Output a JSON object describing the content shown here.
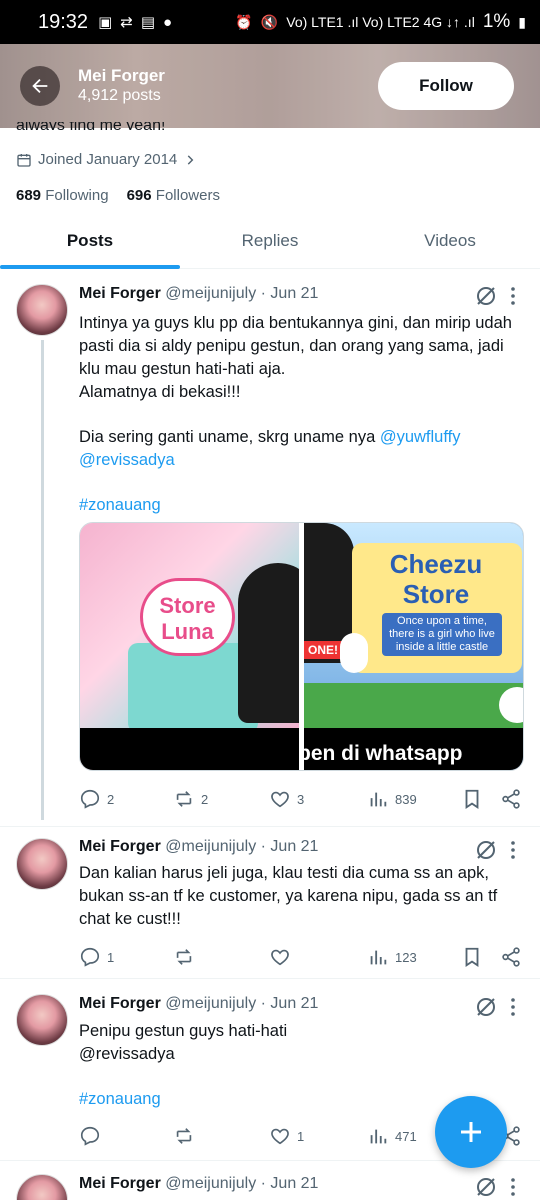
{
  "status_bar": {
    "time": "19:32",
    "network": "Vo) LTE1 .ıl Vo) LTE2 4G ↓↑ .ıl",
    "battery": "1%"
  },
  "header": {
    "name": "Mei Forger",
    "posts": "4,912 posts",
    "follow_label": "Follow"
  },
  "profile": {
    "bio_cut": "always find me yeah!",
    "joined": "Joined January 2014",
    "following_count": "689",
    "following_label": "Following",
    "followers_count": "696",
    "followers_label": "Followers"
  },
  "tabs": [
    {
      "label": "Posts"
    },
    {
      "label": "Replies"
    },
    {
      "label": "Videos"
    }
  ],
  "tweets": [
    {
      "name": "Mei Forger",
      "handle": "@meijunijuly",
      "date": "· Jun 21",
      "line1": "Intinya ya guys klu pp dia bentukannya gini, dan mirip udah pasti dia si aldy penipu gestun, dan orang yang sama, jadi klu mau gestun hati-hati aja.",
      "line2": "Alamatnya di bekasi!!!",
      "line3": "Dia sering ganti uname, skrg uname nya ",
      "mention1": "@yuwfluffy",
      "mention2": "@revissadya",
      "hashtag": "#zonauang",
      "media": {
        "img1_text": "Store Luna",
        "img2_title": "Cheezu Store",
        "img2_sub": "Once upon a time, there is a girl who live inside a little castle",
        "img2_caption": "pen di whatsapp",
        "img2_label": "ONE!"
      },
      "replies": "2",
      "reposts": "2",
      "likes": "3",
      "views": "839"
    },
    {
      "name": "Mei Forger",
      "handle": "@meijunijuly",
      "date": "· Jun 21",
      "text": "Dan kalian harus jeli juga, klau testi dia cuma ss an apk, bukan ss-an tf ke customer, ya karena nipu, gada ss an tf chat ke cust!!!",
      "replies": "1",
      "reposts": "",
      "likes": "",
      "views": "123"
    },
    {
      "name": "Mei Forger",
      "handle": "@meijunijuly",
      "date": "· Jun 21",
      "line1": "Penipu gestun guys hati-hati",
      "line2": "@revissadya",
      "hashtag": "#zonauang",
      "replies": "",
      "reposts": "",
      "likes": "1",
      "views": "471"
    },
    {
      "name": "Mei Forger",
      "handle": "@meijunijuly",
      "date": "· Jun 21"
    }
  ],
  "colors": {
    "accent": "#1d9bf0",
    "text": "#0f1419",
    "muted": "#536471"
  }
}
